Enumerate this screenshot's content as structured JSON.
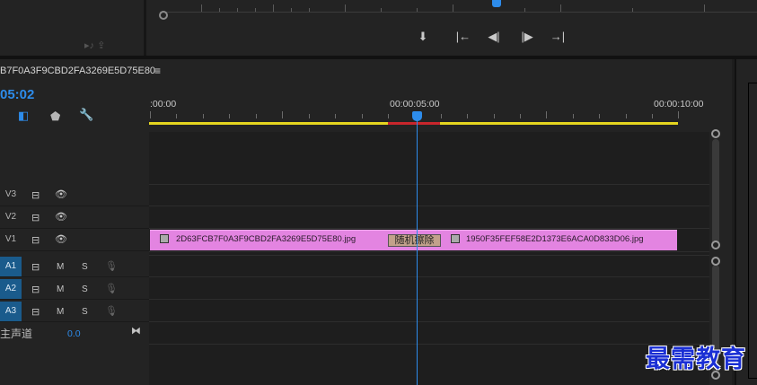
{
  "sequence": {
    "title": "B7F0A3F9CBD2FA3269E5D75E80",
    "menu_glyph": "≡",
    "timecode": "05:02"
  },
  "monitor": {
    "controls": [
      {
        "name": "add-marker-button",
        "glyph": "⬇"
      },
      {
        "name": "mark-in-button",
        "glyph": "|←"
      },
      {
        "name": "step-back-button",
        "glyph": "◀|"
      },
      {
        "name": "step-forward-button",
        "glyph": "|▶"
      },
      {
        "name": "go-to-out-button",
        "glyph": "→|"
      }
    ]
  },
  "ruler": {
    "labels": [
      ":00:00",
      "00:00:05:00",
      "00:00:10:00"
    ]
  },
  "tracks": {
    "video": [
      {
        "label": "V3"
      },
      {
        "label": "V2"
      },
      {
        "label": "V1"
      }
    ],
    "audio": [
      {
        "label": "A1",
        "mute": "M",
        "solo": "S"
      },
      {
        "label": "A2",
        "mute": "M",
        "solo": "S"
      },
      {
        "label": "A3",
        "mute": "M",
        "solo": "S"
      }
    ],
    "master": {
      "label": "主声道",
      "value": "0.0"
    }
  },
  "clips": {
    "v1_left": "2D63FCB7F0A3F9CBD2FA3269E5D75E80.jpg",
    "v1_right": "1950F35FEF58E2D1373E6ACA0D833D06.jpg",
    "transition": "随机擦除"
  },
  "watermark": "最需教育",
  "colors": {
    "accent": "#2d8ceb",
    "clip": "#e384e1",
    "workarea": "#e5d51f",
    "audio_track": "#1a5b8c"
  }
}
